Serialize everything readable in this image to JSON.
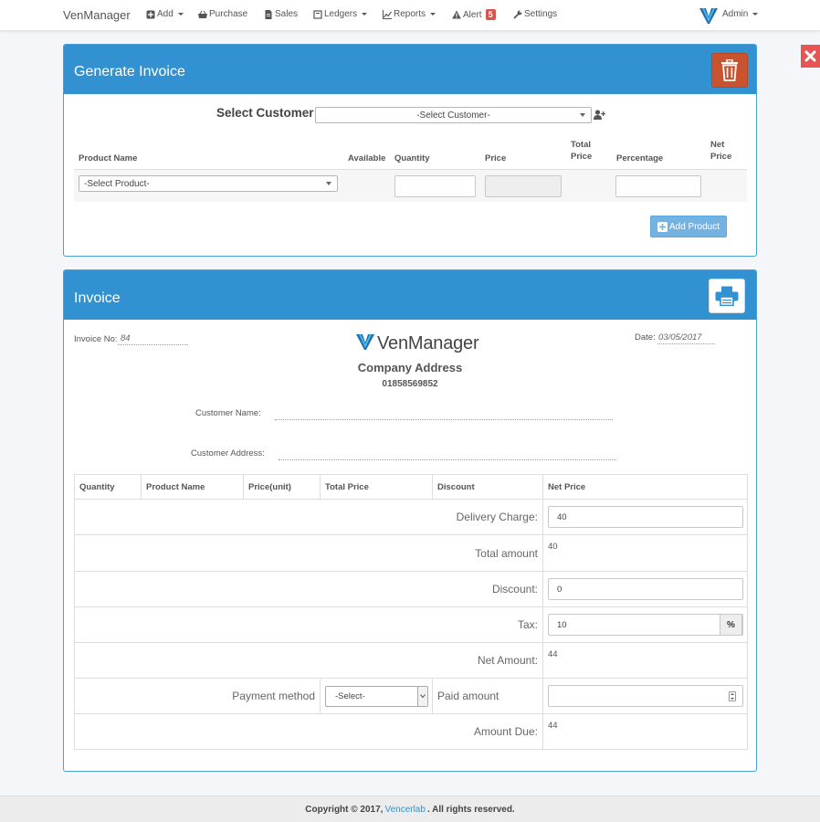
{
  "nav": {
    "brand": "VenManager",
    "items": [
      {
        "label": "Add"
      },
      {
        "label": "Purchase"
      },
      {
        "label": "Sales"
      },
      {
        "label": "Ledgers"
      },
      {
        "label": "Reports"
      },
      {
        "label": "Alert",
        "badge": "5"
      },
      {
        "label": "Settings"
      }
    ],
    "user": "Admin"
  },
  "generate": {
    "title": "Generate Invoice",
    "select_customer_label": "Select Customer",
    "customer_select_value": "-Select Customer-",
    "columns": {
      "product_name": "Product Name",
      "available": "Available",
      "quantity": "Quantity",
      "price": "Price",
      "total_price": "Total Price",
      "percentage": "Percentage",
      "net_price": "Net Price"
    },
    "product_select_value": "-Select Product-",
    "add_product_label": "Add Product"
  },
  "invoice": {
    "title": "Invoice",
    "invoice_no_label": "Invoice No:",
    "invoice_no": "84",
    "date_label": "Date:",
    "date": "03/05/2017",
    "logo_text": "VenManager",
    "company_address": "Company Address",
    "phone": "01858569852",
    "customer_name_label": "Customer Name:",
    "customer_address_label": "Customer Address:",
    "columns": [
      "Quantity",
      "Product Name",
      "Price(unit)",
      "Total Price",
      "Discount",
      "Net Price"
    ],
    "delivery_charge_label": "Delivery Charge:",
    "delivery_charge": "40",
    "total_amount_label": "Total amount",
    "total_amount": "40",
    "discount_label": "Discount:",
    "discount": "0",
    "tax_label": "Tax:",
    "tax": "10",
    "tax_unit": "%",
    "net_amount_label": "Net Amount:",
    "net_amount": "44",
    "payment_method_label": "Payment method",
    "payment_method_value": "-Select-",
    "paid_amount_label": "Paid amount",
    "paid_amount": "",
    "amount_due_label": "Amount Due:",
    "amount_due": "44"
  },
  "footer": {
    "prefix": "Copyright © 2017,",
    "link": "Vencerlab",
    "suffix": ". All rights reserved."
  },
  "colors": {
    "primary": "#3292d1",
    "delete_button": "#c9532f",
    "close_side": "#e85454",
    "alert_badge": "#d9534f"
  }
}
